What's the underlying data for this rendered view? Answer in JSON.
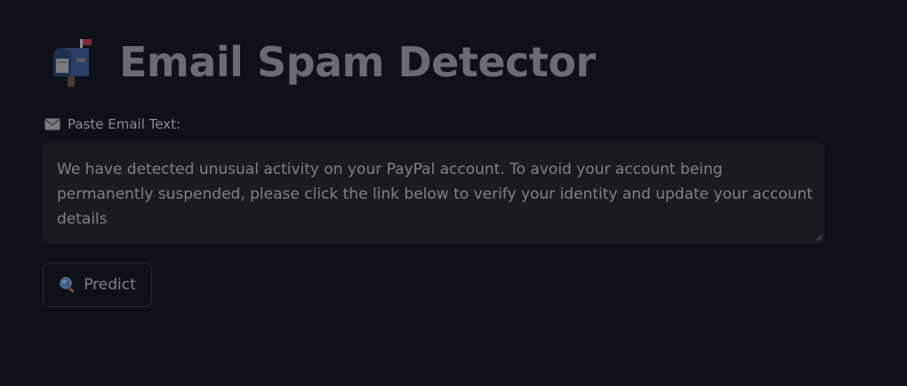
{
  "header": {
    "title": "Email Spam Detector",
    "icon": "mailbox-icon"
  },
  "email_input": {
    "label": "Paste Email Text:",
    "label_icon": "envelope-icon",
    "value": "We have detected unusual activity on your PayPal account. To avoid your account being permanently suspended, please click the link below to verify your identity and update your account details"
  },
  "predict_button": {
    "label": "Predict",
    "icon": "magnifier-icon"
  },
  "colors": {
    "background": "#0e1117",
    "input_background": "#191b21",
    "text": "#7f8187",
    "title": "#6a6c73"
  }
}
